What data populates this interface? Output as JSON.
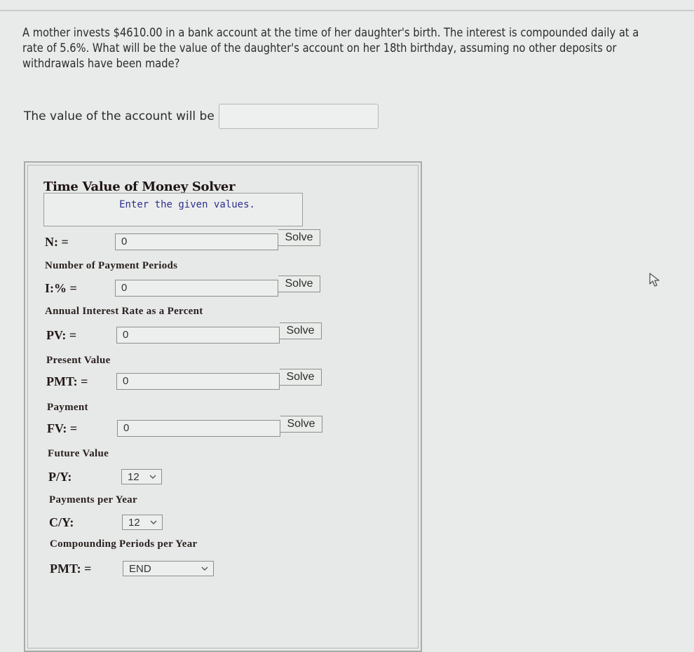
{
  "question": {
    "text": "A mother invests $4610.00 in a bank account at the time of her daughter's birth. The interest is compounded daily at a rate of 5.6%. What will be the value of the daughter's account on her 18th birthday, assuming no other deposits or withdrawals have been made?"
  },
  "answer": {
    "label": "The value of the account will be",
    "value": ""
  },
  "solver": {
    "title": "Time Value of Money Solver",
    "message": "Enter the given values.",
    "fields": [
      {
        "label": "N: =",
        "value": "0",
        "solve_label": "Solve",
        "description": "Number of Payment Periods"
      },
      {
        "label": "I:% =",
        "value": "0",
        "solve_label": "Solve",
        "description": "Annual Interest Rate as a Percent"
      },
      {
        "label": "PV: =",
        "value": "0",
        "solve_label": "Solve",
        "description": "Present Value"
      },
      {
        "label": "PMT: =",
        "value": "0",
        "solve_label": "Solve",
        "description": "Payment"
      },
      {
        "label": "FV: =",
        "value": "0",
        "solve_label": "Solve",
        "description": "Future Value"
      }
    ],
    "selects": [
      {
        "label": "P/Y:",
        "value": "12",
        "description": "Payments per Year"
      },
      {
        "label": "C/Y:",
        "value": "12",
        "description": "Compounding Periods per Year"
      },
      {
        "label": "PMT: =",
        "value": "END"
      }
    ]
  },
  "icons": {
    "cursor": "mouse-pointer-icon",
    "chevron": "chevron-down-icon"
  }
}
